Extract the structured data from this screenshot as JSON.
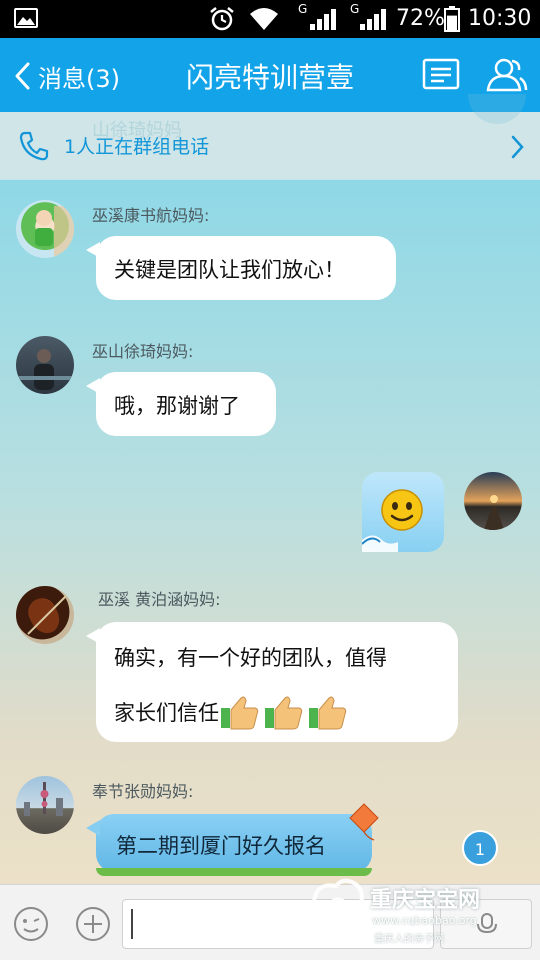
{
  "status_bar": {
    "signal_labels": [
      "G",
      "G"
    ],
    "battery_percent": "72%",
    "time": "10:30",
    "battery_level": 0.72
  },
  "header": {
    "back_label": "消息(3)",
    "title": "闪亮特训营壹",
    "icons": [
      "chevron-left-icon",
      "group-profile-icon",
      "members-icon"
    ]
  },
  "call_banner": {
    "ghost_text": "山徐琦妈妈",
    "text": "1人正在群组电话",
    "icons": [
      "phone-icon",
      "chevron-right-icon"
    ]
  },
  "messages": [
    {
      "sender": "巫溪康书航妈妈:",
      "text": "关键是团队让我们放心！",
      "avatar": "child-photo-avatar"
    },
    {
      "sender": "巫山徐琦妈妈:",
      "text": "哦，那谢谢了",
      "avatar": "dark-photo-avatar"
    },
    {
      "sender": "",
      "emoji": "smiley-face",
      "avatar": "sunset-photo-avatar",
      "mine": true
    },
    {
      "sender": "巫溪  黄泊涵妈妈:",
      "text_line1": "确实，有一个好的团队，值得",
      "text_line2": "家长们信任",
      "emoji": "thumbs-up-icon x3",
      "avatar": "violin-photo-avatar"
    },
    {
      "sender": "奉节张勋妈妈:",
      "text": "第二期到厦门好久报名",
      "avatar": "city-skyline-avatar"
    }
  ],
  "unread_badge": "1",
  "input_bar": {
    "value": "",
    "icons": [
      "emoji-icon",
      "plus-icon",
      "voice-icon"
    ]
  },
  "watermark": {
    "name": "重庆宝宝网",
    "url": "www.cqbaobao.org",
    "slogan": "重庆人的亲子网"
  },
  "colors": {
    "accent": "#12a3e8",
    "call_text": "#1296d8",
    "unread_badge": "#3aa0dd"
  }
}
